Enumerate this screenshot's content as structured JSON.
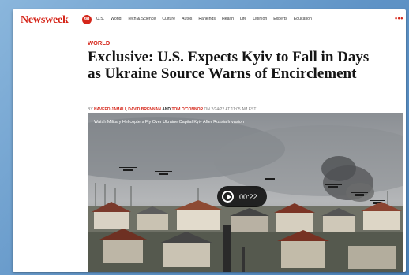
{
  "site": {
    "logo": "Newsweek",
    "badge": "90",
    "nav": [
      "U.S.",
      "World",
      "Tech & Science",
      "Culture",
      "Autos",
      "Rankings",
      "Health",
      "Life",
      "Opinion",
      "Experts",
      "Education"
    ],
    "more": "•••"
  },
  "article": {
    "section": "WORLD",
    "headline": "Exclusive: U.S. Expects Kyiv to Fall in Days as Ukraine Source Warns of Encirclement",
    "byline": {
      "by": "BY",
      "author1": "NAVEED JAMALI",
      "sep1": ",",
      "author2": "DAVID BRENNAN",
      "and": "AND",
      "author3": "TOM O'CONNOR",
      "date": "ON 2/24/22 AT 11:05 AM EST"
    }
  },
  "video": {
    "title": "Watch Military Helicopters Fly Over Ukraine Capital Kyiv After Russia Invasion",
    "time": "00:22"
  },
  "colors": {
    "brand": "#d5261a",
    "background": "#6e9fcf"
  }
}
